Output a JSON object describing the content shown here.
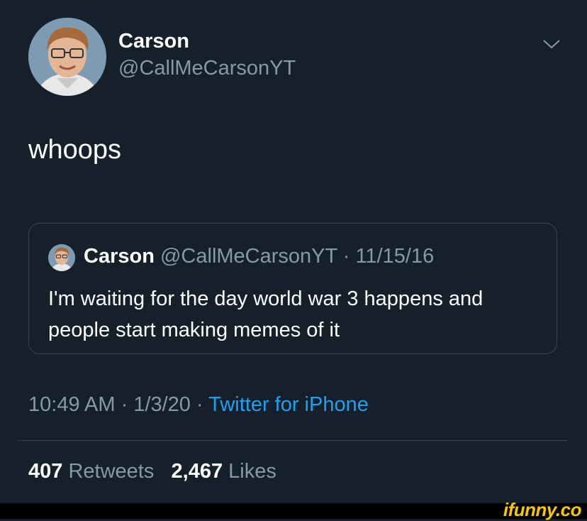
{
  "tweet": {
    "author_name": "Carson",
    "author_handle": "@CallMeCarsonYT",
    "text": "whoops",
    "time": "10:49 AM",
    "date": "1/3/20",
    "separator": " · ",
    "source": "Twitter for iPhone"
  },
  "quoted_tweet": {
    "author_name": "Carson",
    "author_handle": "@CallMeCarsonYT",
    "date_meta": " · 11/15/16",
    "text": "I'm waiting for the day world war 3 happens and people start making memes of it"
  },
  "stats": {
    "retweets_count": "407",
    "retweets_label": "Retweets",
    "likes_count": "2,467",
    "likes_label": "Likes"
  },
  "watermark": "ifunny.co",
  "icons": {
    "menu": "chevron-down-icon"
  },
  "colors": {
    "background": "#15202b",
    "secondary_text": "#8899a6",
    "link": "#1da1f2",
    "border": "#38444d"
  }
}
